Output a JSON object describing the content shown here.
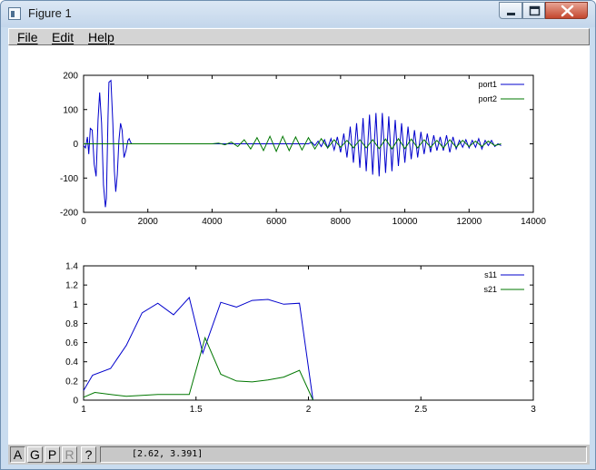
{
  "window": {
    "title": "Figure 1",
    "controls": {
      "minimize": "minimize",
      "maximize": "maximize",
      "close": "close"
    }
  },
  "menu": {
    "items": [
      "File",
      "Edit",
      "Help"
    ]
  },
  "toolbar": {
    "buttons": [
      {
        "label": "A",
        "state": "pressed"
      },
      {
        "label": "G",
        "state": "normal"
      },
      {
        "label": "P",
        "state": "normal"
      },
      {
        "label": "R",
        "state": "disabled"
      },
      {
        "label": "?",
        "state": "normal"
      }
    ],
    "coordinates": "[2.62, 3.391]"
  },
  "chart_data": [
    {
      "type": "line",
      "xlim": [
        0,
        14000
      ],
      "ylim": [
        -200,
        200
      ],
      "xticks": [
        0,
        2000,
        4000,
        6000,
        8000,
        10000,
        12000,
        14000
      ],
      "yticks": [
        -200,
        -100,
        0,
        100,
        200
      ],
      "legend_position": "top-right",
      "series": [
        {
          "name": "port1",
          "color": "#0000cc",
          "x": [
            0,
            60,
            120,
            160,
            210,
            270,
            330,
            390,
            450,
            500,
            560,
            620,
            680,
            710,
            760,
            790,
            850,
            910,
            960,
            1000,
            1050,
            1100,
            1150,
            1200,
            1260,
            1320,
            1380,
            1420,
            1460,
            1500,
            1600,
            2000,
            2500,
            3000,
            3500,
            4000,
            4500,
            5000,
            5500,
            6000,
            6500,
            7000,
            7100,
            7200,
            7300,
            7400,
            7500,
            7600,
            7700,
            7800,
            7900,
            8000,
            8100,
            8200,
            8300,
            8400,
            8500,
            8600,
            8700,
            8800,
            8900,
            9000,
            9100,
            9200,
            9300,
            9400,
            9500,
            9600,
            9700,
            9800,
            9900,
            10000,
            10100,
            10200,
            10300,
            10400,
            10500,
            10600,
            10700,
            10800,
            10900,
            11000,
            11100,
            11200,
            11300,
            11400,
            11500,
            11600,
            11700,
            11800,
            11900,
            12000,
            12100,
            12200,
            12300,
            12400,
            12500,
            12600,
            12700,
            12800,
            12900,
            13000
          ],
          "y": [
            -5,
            -12,
            20,
            -30,
            45,
            40,
            -60,
            -95,
            70,
            150,
            60,
            -120,
            -185,
            -160,
            80,
            180,
            185,
            60,
            -80,
            -140,
            -90,
            10,
            60,
            40,
            -40,
            -20,
            10,
            15,
            5,
            0,
            0,
            0,
            0,
            0,
            0,
            0,
            0,
            0,
            0,
            0,
            0,
            0,
            5,
            -5,
            8,
            -8,
            12,
            -12,
            15,
            -18,
            20,
            -25,
            30,
            -40,
            50,
            -55,
            60,
            -70,
            75,
            -80,
            85,
            -90,
            90,
            -95,
            90,
            -85,
            80,
            -80,
            70,
            -65,
            60,
            -55,
            50,
            -45,
            40,
            -40,
            35,
            -30,
            30,
            -25,
            25,
            -20,
            20,
            -20,
            25,
            -25,
            20,
            -15,
            10,
            -10,
            12,
            -12,
            10,
            -10,
            15,
            -15,
            10,
            -5,
            10,
            -8,
            0,
            -5
          ]
        },
        {
          "name": "port2",
          "color": "#007700",
          "x": [
            0,
            1500,
            2000,
            2500,
            3000,
            3500,
            4000,
            4200,
            4400,
            4600,
            4800,
            5000,
            5200,
            5400,
            5600,
            5800,
            6000,
            6200,
            6400,
            6600,
            6800,
            7000,
            7200,
            7400,
            7600,
            7800,
            8000,
            8200,
            8400,
            8600,
            8800,
            9000,
            9200,
            9400,
            9600,
            9800,
            10000,
            10200,
            10400,
            10600,
            10800,
            11000,
            11200,
            11400,
            11600,
            11800,
            12000,
            12200,
            12400,
            12600,
            12800,
            13000
          ],
          "y": [
            0,
            0,
            0,
            0,
            0,
            0,
            0,
            2,
            -3,
            5,
            -8,
            12,
            -15,
            18,
            -20,
            22,
            -22,
            22,
            -20,
            20,
            -18,
            18,
            -15,
            15,
            -12,
            12,
            -10,
            10,
            -12,
            12,
            -12,
            12,
            -14,
            14,
            -15,
            15,
            -14,
            14,
            -12,
            12,
            -10,
            10,
            -12,
            12,
            -10,
            10,
            -8,
            8,
            -8,
            8,
            -5,
            0
          ]
        }
      ]
    },
    {
      "type": "line",
      "xlim": [
        1,
        3
      ],
      "ylim": [
        0,
        1.4
      ],
      "xticks": [
        1,
        1.5,
        2,
        2.5,
        3
      ],
      "yticks": [
        0,
        0.2,
        0.4,
        0.6,
        0.8,
        1,
        1.2,
        1.4
      ],
      "legend_position": "top-right",
      "series": [
        {
          "name": "s11",
          "color": "#0000cc",
          "x": [
            1.0,
            1.04,
            1.12,
            1.19,
            1.26,
            1.33,
            1.4,
            1.47,
            1.53,
            1.61,
            1.68,
            1.75,
            1.82,
            1.89,
            1.96,
            2.02
          ],
          "y": [
            0.1,
            0.26,
            0.33,
            0.57,
            0.91,
            1.01,
            0.89,
            1.07,
            0.49,
            1.02,
            0.97,
            1.04,
            1.05,
            1.0,
            1.01,
            0.0
          ]
        },
        {
          "name": "s21",
          "color": "#007700",
          "x": [
            1.0,
            1.05,
            1.12,
            1.19,
            1.26,
            1.33,
            1.4,
            1.47,
            1.54,
            1.61,
            1.68,
            1.75,
            1.82,
            1.89,
            1.96,
            2.02
          ],
          "y": [
            0.03,
            0.08,
            0.06,
            0.04,
            0.05,
            0.06,
            0.06,
            0.06,
            0.65,
            0.27,
            0.2,
            0.19,
            0.21,
            0.24,
            0.31,
            0.0
          ]
        }
      ]
    }
  ]
}
